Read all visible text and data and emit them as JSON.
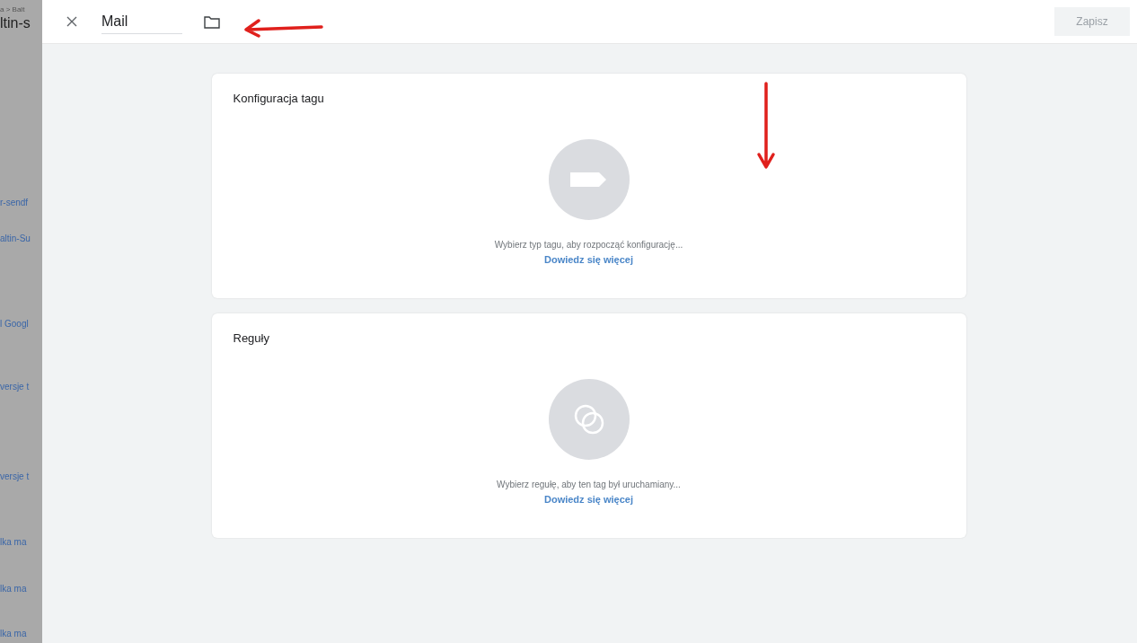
{
  "backdrop": {
    "breadcrumb": "a > Balt",
    "title": "ltin-s",
    "items": [
      "r-sendf",
      "altin-Su",
      "l Googl",
      "versje t",
      "versje t",
      "lka ma",
      "lka ma",
      "lka ma"
    ]
  },
  "header": {
    "name_field": {
      "value": "Mail"
    },
    "save_button": {
      "label": "Zapisz",
      "disabled": true
    }
  },
  "cards": [
    {
      "kind": "tag",
      "title": "Konfiguracja tagu",
      "message": "Wybierz typ tagu, aby rozpocząć konfigurację...",
      "link": "Dowiedz się więcej"
    },
    {
      "kind": "trigger",
      "title": "Reguły",
      "message": "Wybierz regułę, aby ten tag był uruchamiany...",
      "link": "Dowiedz się więcej"
    }
  ],
  "annotations": [
    {
      "kind": "left"
    },
    {
      "kind": "down"
    }
  ]
}
